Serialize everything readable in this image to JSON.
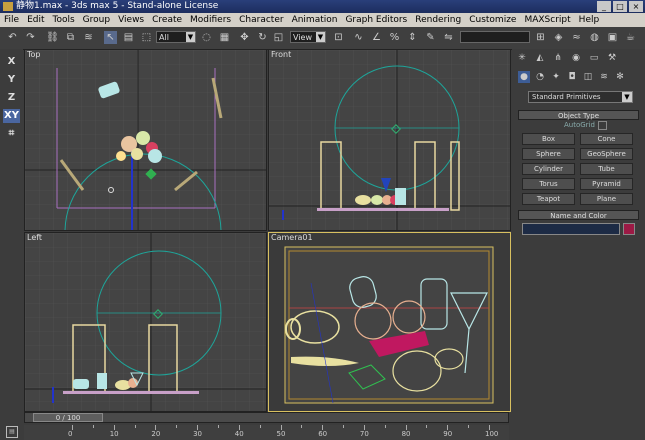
{
  "window": {
    "title": "静物1.max - 3ds max 5 - Stand-alone License",
    "buttons": [
      "_",
      "□",
      "×"
    ]
  },
  "menu": [
    "File",
    "Edit",
    "Tools",
    "Group",
    "Views",
    "Create",
    "Modifiers",
    "Character",
    "Animation",
    "Graph Editors",
    "Rendering",
    "Customize",
    "MAXScript",
    "Help"
  ],
  "toolbar": {
    "selection_filter": "All",
    "ref_coord": "View",
    "icons": [
      "undo-icon",
      "redo-icon",
      "link-icon",
      "unlink-icon",
      "bind-space-warp-icon",
      "select-icon",
      "select-by-name-icon",
      "selection-region-icon",
      "select-move-icon",
      "select-rotate-icon",
      "select-scale-icon"
    ]
  },
  "axis_constraints": [
    "X",
    "Y",
    "Z",
    "XY"
  ],
  "viewports": {
    "top": "Top",
    "front": "Front",
    "left": "Left",
    "camera": "Camera01"
  },
  "command_panel": {
    "category": "Standard Primitives",
    "object_type_title": "Object Type",
    "autogrid": "AutoGrid",
    "objects": [
      "Box",
      "Cone",
      "Sphere",
      "GeoSphere",
      "Cylinder",
      "Tube",
      "Torus",
      "Pyramid",
      "Teapot",
      "Plane"
    ],
    "name_color_title": "Name and Color",
    "color": "#9c1a45"
  },
  "timeline": {
    "frame_display": "0 / 100",
    "tick_labels": [
      "0",
      "10",
      "20",
      "30",
      "40",
      "50",
      "60",
      "70",
      "80",
      "90",
      "100"
    ]
  }
}
